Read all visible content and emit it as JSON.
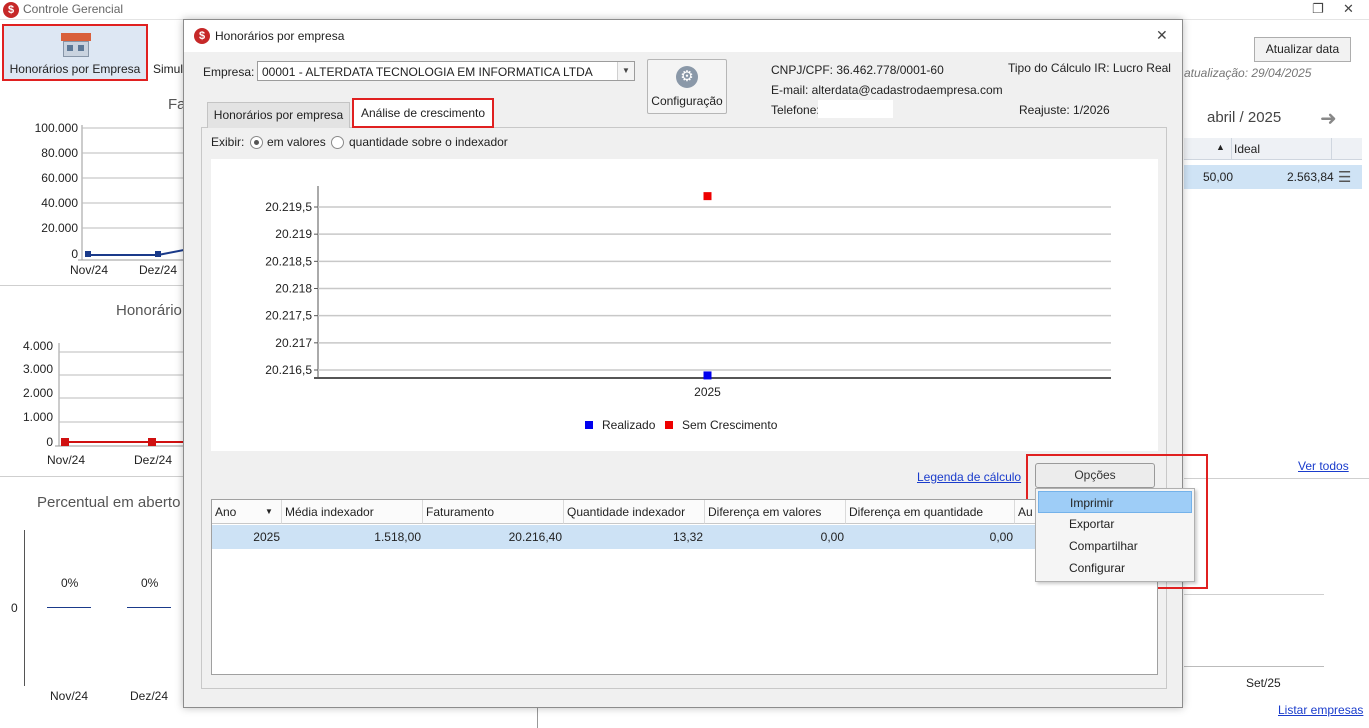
{
  "app": {
    "title": "Controle Gerencial",
    "toolbar": {
      "honorarios_label": "Honorários por Empresa",
      "simul_label": "Simul"
    }
  },
  "background": {
    "chart1": {
      "title": "Fa",
      "yticks": [
        "100.000",
        "80.000",
        "60.000",
        "40.000",
        "20.000",
        "0"
      ],
      "xticks": [
        "Nov/24",
        "Dez/24"
      ]
    },
    "chart2": {
      "title": "Honorário",
      "yticks": [
        "4.000",
        "3.000",
        "2.000",
        "1.000",
        "0"
      ],
      "xticks": [
        "Nov/24",
        "Dez/24"
      ]
    },
    "chart3": {
      "title": "Percentual em aberto",
      "ytick": "0",
      "bars": [
        "0%",
        "0%"
      ],
      "xticks": [
        "Nov/24",
        "Dez/24"
      ],
      "right_xtick": "Set/25"
    },
    "right_panel": {
      "update_button": "Atualizar data",
      "update_info": "atualização: 29/04/2025",
      "month": "abril / 2025",
      "grid_header": {
        "sort_icon": "▲",
        "col_ideal": "Ideal"
      },
      "grid_row": {
        "value1": "50,00",
        "value2": "2.563,84"
      },
      "link_ver_todos": "Ver todos",
      "link_listar": "Listar empresas"
    }
  },
  "dialog": {
    "title": "Honorários por empresa",
    "empresa_label": "Empresa:",
    "empresa_value": "00001 - ALTERDATA TECNOLOGIA EM INFORMATICA LTDA",
    "config_button": "Configuração",
    "cnpj": "CNPJ/CPF: 36.462.778/0001-60",
    "email": "E-mail: alterdata@cadastrodaempresa.com",
    "telefone": "Telefone:",
    "tipo_calculo": "Tipo do Cálculo IR: Lucro Real",
    "reajuste": "Reajuste: 1/2026",
    "tabs": [
      "Honorários por empresa",
      "Análise de crescimento"
    ],
    "exibir_label": "Exibir:",
    "radio_valores": "em valores",
    "radio_quantidade": "quantidade sobre o indexador",
    "legenda_link": "Legenda de cálculo",
    "opcoes_button": "Opções",
    "menu": [
      "Imprimir",
      "Exportar",
      "Compartilhar",
      "Configurar"
    ],
    "table": {
      "headers": [
        "Ano",
        "Média indexador",
        "Faturamento",
        "Quantidade indexador",
        "Diferença em valores",
        "Diferença em quantidade",
        "Au"
      ],
      "rows": [
        [
          "2025",
          "1.518,00",
          "20.216,40",
          "13,32",
          "0,00",
          "0,00"
        ]
      ]
    }
  },
  "colors": {
    "realizado": "#0000ee",
    "sem_crescimento": "#ee0000",
    "highlight": "#e02020",
    "selection": "#cde2f5"
  },
  "chart_data": {
    "type": "scatter",
    "x": [
      "2025"
    ],
    "series": [
      {
        "name": "Realizado",
        "values": [
          20216.4
        ]
      },
      {
        "name": "Sem Crescimento",
        "values": [
          20219.7
        ]
      }
    ],
    "yticks": [
      "20.219,5",
      "20.219",
      "20.218,5",
      "20.218",
      "20.217,5",
      "20.217",
      "20.216,5"
    ],
    "ylim": [
      20216.5,
      20219.5
    ],
    "grid": true,
    "legend": "bottom"
  }
}
